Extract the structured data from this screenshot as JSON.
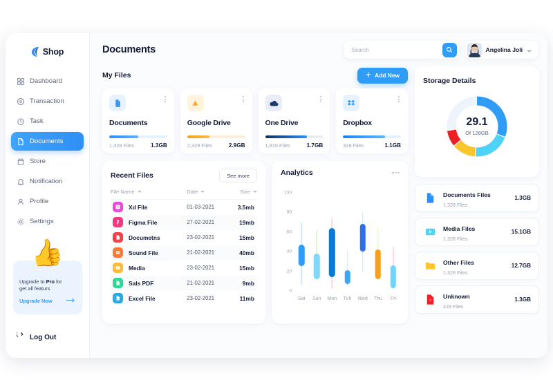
{
  "brand": {
    "name": "Shop",
    "logo_icon": "shop-logo-icon"
  },
  "sidebar": {
    "items": [
      {
        "label": "Dashboard",
        "icon": "grid-icon",
        "active": false
      },
      {
        "label": "Transaction",
        "icon": "transaction-icon",
        "active": false
      },
      {
        "label": "Task",
        "icon": "clock-icon",
        "active": false
      },
      {
        "label": "Documents",
        "icon": "document-icon",
        "active": true
      },
      {
        "label": "Store",
        "icon": "store-icon",
        "active": false
      },
      {
        "label": "Notification",
        "icon": "bell-icon",
        "active": false
      },
      {
        "label": "Profile",
        "icon": "user-icon",
        "active": false
      },
      {
        "label": "Settings",
        "icon": "gear-icon",
        "active": false
      }
    ],
    "promo": {
      "line1_prefix": "Upgrade to ",
      "line1_strong": "Pro",
      "line1_suffix": " for",
      "line2": "get all featurs",
      "cta": "Upgrade Now",
      "hand_icon": "thumbs-up-icon"
    },
    "logout": {
      "label": "Log Out",
      "icon": "logout-icon"
    }
  },
  "header": {
    "title": "Documents",
    "search": {
      "value": "",
      "placeholder": "Search",
      "button_icon": "search-icon"
    },
    "profile": {
      "name": "Angelina Joli",
      "avatar_icon": "avatar",
      "chevron_icon": "chevron-down-icon"
    }
  },
  "my_files": {
    "title": "My Files",
    "add_button": {
      "label": "Add New",
      "icon": "plus-icon"
    },
    "cards": [
      {
        "name": "Documents",
        "icon": "file-icon",
        "icon_bg": "#e6f2ff",
        "icon_color": "#2f8ff5",
        "files": "1,328 Files",
        "size": "1.3GB",
        "progress": 50,
        "bar_color": "#2f8ff5",
        "track_color": "#e6f2ff",
        "menu_icon": "more-vertical-icon"
      },
      {
        "name": "Google Drive",
        "icon": "gdrive-icon",
        "icon_bg": "#fff3dd",
        "icon_color": "#f9a825",
        "files": "2,329 Files",
        "size": "2.9GB",
        "progress": 38,
        "bar_color": "#f9a825",
        "track_color": "#fdf0da",
        "menu_icon": "more-vertical-icon"
      },
      {
        "name": "One Drive",
        "icon": "onedrive-icon",
        "icon_bg": "#e9edf5",
        "icon_color": "#1a3a6b",
        "files": "1,916 Files",
        "size": "1.7GB",
        "progress": 72,
        "bar_color": "#1a5fb4",
        "track_color": "#e9eef6",
        "menu_icon": "more-vertical-icon"
      },
      {
        "name": "Dropbox",
        "icon": "dropbox-icon",
        "icon_bg": "#e6f2ff",
        "icon_color": "#2f9cf7",
        "files": "328 Files",
        "size": "1.1GB",
        "progress": 72,
        "bar_color": "#2f9cf7",
        "track_color": "#e3f1ff",
        "menu_icon": "more-vertical-icon"
      }
    ]
  },
  "recent_files": {
    "title": "Recent Files",
    "see_more": "See more",
    "columns": [
      "File Name",
      "Date",
      "Size"
    ],
    "rows": [
      {
        "name": "Xd File",
        "date": "01-03-2021",
        "size": "3.5mb",
        "icon": "xd-file-icon",
        "icon_color": "#ec4bd8"
      },
      {
        "name": "Figma File",
        "date": "27-02-2021",
        "size": "19mb",
        "icon": "figma-file-icon",
        "icon_color": "#f5377f"
      },
      {
        "name": "Documetns",
        "date": "23-02-2021",
        "size": "15mb",
        "icon": "document-file-icon",
        "icon_color": "#f6414a"
      },
      {
        "name": "Sound File",
        "date": "21-02-2021",
        "size": "40mb",
        "icon": "sound-file-icon",
        "icon_color": "#f97b3a"
      },
      {
        "name": "Media",
        "date": "23-02-2021",
        "size": "15mb",
        "icon": "media-file-icon",
        "icon_color": "#fbbb3c"
      },
      {
        "name": "Sals PDF",
        "date": "21-02-2021",
        "size": "9mb",
        "icon": "pdf-file-icon",
        "icon_color": "#2fd897"
      },
      {
        "name": "Excel File",
        "date": "23-02-2021",
        "size": "11mb",
        "icon": "excel-file-icon",
        "icon_color": "#28a9e8"
      }
    ]
  },
  "analytics": {
    "title": "Analytics",
    "menu_icon": "more-horizontal-icon"
  },
  "chart_data": {
    "type": "bar",
    "title": "Analytics",
    "xlabel": "",
    "ylabel": "",
    "ylim": [
      0,
      100
    ],
    "yticks": [
      0,
      20,
      40,
      60,
      80,
      100
    ],
    "grid": false,
    "legend": "none",
    "categories": [
      "Sat",
      "Sun",
      "Mon",
      "Tuh",
      "Wed",
      "Thu",
      "Fri"
    ],
    "series": [
      {
        "name": "low",
        "values": [
          6,
          11,
          2,
          5,
          19,
          11,
          2
        ]
      },
      {
        "name": "open",
        "values": [
          25,
          12,
          14,
          7,
          40,
          12,
          3
        ]
      },
      {
        "name": "close",
        "values": [
          47,
          38,
          64,
          21,
          68,
          42,
          26
        ]
      },
      {
        "name": "high",
        "values": [
          70,
          62,
          75,
          41,
          80,
          64,
          45
        ]
      }
    ],
    "bar_colors": [
      "#2f9cf7",
      "#7fd7fb",
      "#0b79d8",
      "#3aa8f5",
      "#2f6fe8",
      "#f9a01b",
      "#6fd4fb"
    ],
    "wick_colors": [
      "#cfe6fb",
      "#dff3cd",
      "#fbd9dd",
      "#cfe6fb",
      "#cfe6fb",
      "#dff3cd",
      "#fbd9dd"
    ]
  },
  "storage": {
    "title": "Storage Details",
    "used": "29.1",
    "total_label": "Of 128GB",
    "donut_segments": [
      {
        "name": "documents",
        "color": "#2f9cf7",
        "percent": 31
      },
      {
        "name": "media",
        "color": "#4fd2f7",
        "percent": 20
      },
      {
        "name": "other",
        "color": "#fbc52e",
        "percent": 13
      },
      {
        "name": "unknown",
        "color": "#ed2024",
        "percent": 9
      },
      {
        "name": "free",
        "color": "#eef4fb",
        "percent": 27
      }
    ],
    "rows": [
      {
        "title": "Documents Files",
        "files": "1,328 Files",
        "size": "1.3GB",
        "icon": "document-file-icon",
        "icon_color": "#2f8ff5"
      },
      {
        "title": "Media Files",
        "files": "1,328 Files",
        "size": "15.1GB",
        "icon": "media-file-icon",
        "icon_color": "#4fd2f7"
      },
      {
        "title": "Other Files",
        "files": "1,328 Files",
        "size": "12.7GB",
        "icon": "folder-icon",
        "icon_color": "#fbc52e"
      },
      {
        "title": "Unknown",
        "files": "428 Files",
        "size": "1.3GB",
        "icon": "unknown-file-icon",
        "icon_color": "#ed2024"
      }
    ]
  }
}
